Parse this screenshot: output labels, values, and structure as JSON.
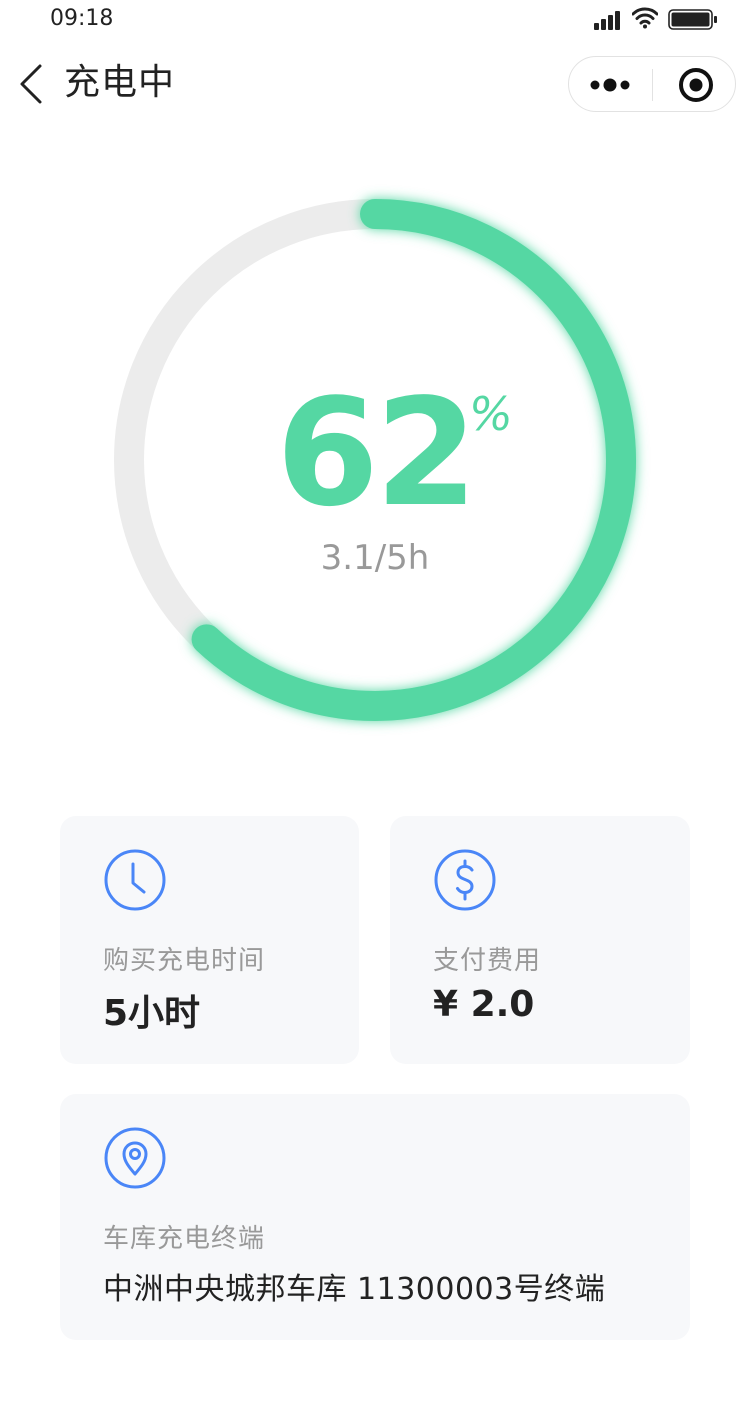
{
  "status_bar": {
    "time": "09:18",
    "icons": [
      "signal-icon",
      "wifi-icon",
      "battery-icon"
    ]
  },
  "nav": {
    "title": "充电中",
    "back_icon": "chevron-left-icon",
    "capsule_icons": [
      "more-icon",
      "close-mini-icon"
    ]
  },
  "progress": {
    "percent": "62",
    "percent_sign": "%",
    "fraction": 0.62,
    "time_text": "3.1/5h",
    "accent_color": "#55d7a3",
    "track_color": "#ececec"
  },
  "cards": {
    "time": {
      "icon": "clock-icon",
      "label": "购买充电时间",
      "value": "5小时"
    },
    "fee": {
      "icon": "dollar-icon",
      "label": "支付费用",
      "value": "¥ 2.0"
    },
    "terminal": {
      "icon": "location-pin-icon",
      "label": "车库充电终端",
      "value": "中洲中央城邦车库 11300003号终端"
    }
  },
  "colors": {
    "icon_blue": "#4a86f7",
    "card_bg": "#f7f8fa"
  }
}
